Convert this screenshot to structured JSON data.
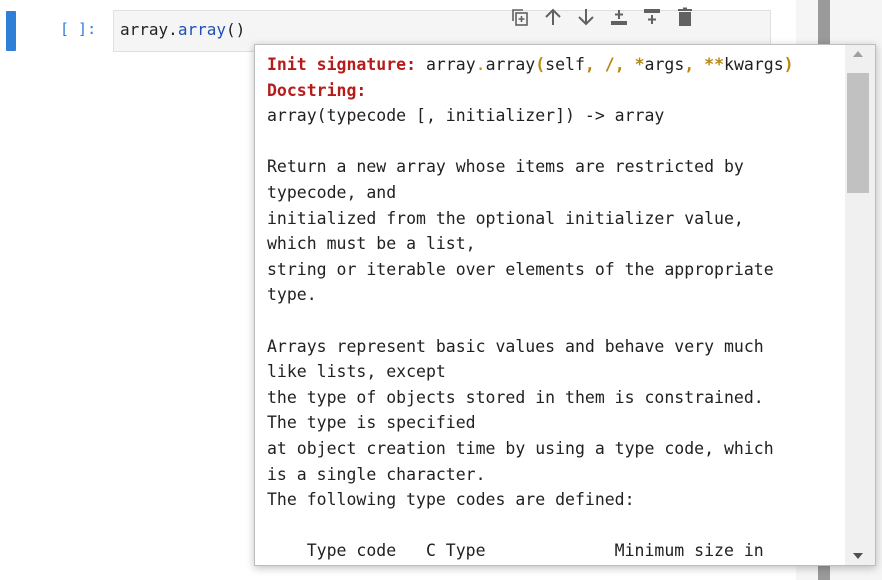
{
  "cell": {
    "prompt": "[ ]:",
    "code_object": "array",
    "code_dot": ".",
    "code_function": "array",
    "code_parens": "()"
  },
  "toolbar": {
    "buttons": [
      {
        "name": "copy-cell-icon"
      },
      {
        "name": "move-up-icon"
      },
      {
        "name": "move-down-icon"
      },
      {
        "name": "insert-above-icon"
      },
      {
        "name": "insert-below-icon"
      },
      {
        "name": "delete-icon"
      }
    ]
  },
  "tooltip": {
    "signature_label": "Init signature:",
    "signature_pre": "array",
    "signature_dot": ".",
    "signature_fn": "array",
    "signature_open": "(",
    "signature_self": "self",
    "signature_comma1": ",",
    "signature_slash": "/",
    "signature_comma2": ",",
    "signature_star": "*",
    "signature_args": "args",
    "signature_comma3": ",",
    "signature_dstar": "**",
    "signature_kwargs": "kwargs",
    "signature_close": ")",
    "docstring_label": "Docstring:",
    "lines": [
      "array(typecode [, initializer]) -> array",
      "",
      "Return a new array whose items are restricted by",
      "typecode, and",
      "initialized from the optional initializer value,",
      "which must be a list,",
      "string or iterable over elements of the appropriate",
      "type.",
      "",
      "Arrays represent basic values and behave very much",
      "like lists, except",
      "the type of objects stored in them is constrained.",
      "The type is specified",
      "at object creation time by using a type code, which",
      "is a single character.",
      "The following type codes are defined:",
      "",
      "    Type code   C Type             Minimum size in"
    ]
  },
  "colors": {
    "accent": "#2f7fd8",
    "label_red": "#b71c1c",
    "signature_gold": "#b8860b"
  }
}
